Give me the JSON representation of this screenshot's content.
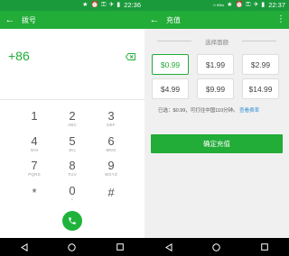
{
  "left": {
    "status": {
      "time": "22:36"
    },
    "title": "拨号",
    "dialed": "+86",
    "keys": [
      {
        "digit": "1",
        "letters": ""
      },
      {
        "digit": "2",
        "letters": "ABC"
      },
      {
        "digit": "3",
        "letters": "DEF"
      },
      {
        "digit": "4",
        "letters": "GHI"
      },
      {
        "digit": "5",
        "letters": "JKL"
      },
      {
        "digit": "6",
        "letters": "MNO"
      },
      {
        "digit": "7",
        "letters": "PQRS"
      },
      {
        "digit": "8",
        "letters": "TUV"
      },
      {
        "digit": "9",
        "letters": "WXYZ"
      },
      {
        "digit": "*",
        "letters": ""
      },
      {
        "digit": "0",
        "letters": "+"
      },
      {
        "digit": "#",
        "letters": ""
      }
    ]
  },
  "right": {
    "status": {
      "time": "22:37",
      "speed": "0 KB/s"
    },
    "title": "充值",
    "section_label": "选择面额",
    "amounts": [
      "$0.99",
      "$1.99",
      "$2.99",
      "$4.99",
      "$9.99",
      "$14.99"
    ],
    "selected_amount": "$0.99",
    "info": {
      "prefix": "已选：",
      "value": "$0.99，可打往中国110分钟。",
      "link": "查看费率"
    },
    "confirm_label": "确定充值"
  },
  "colors": {
    "accent": "#22ac38",
    "status_bar": "#1a9a3b",
    "link": "#2b8fd6"
  }
}
